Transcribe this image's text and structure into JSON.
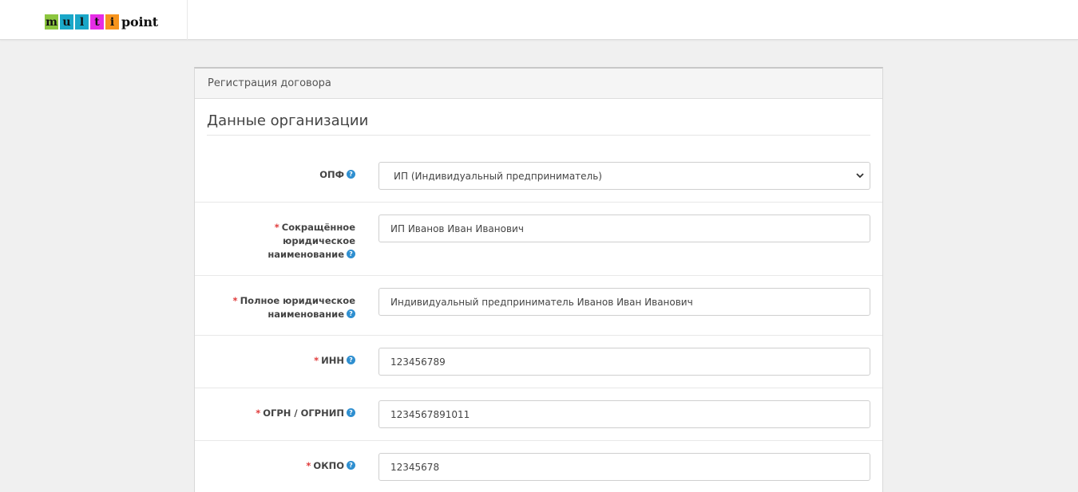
{
  "brand": {
    "letters": [
      {
        "char": "m",
        "color": "#8cc63f"
      },
      {
        "char": "u",
        "color": "#1aa7c8"
      },
      {
        "char": "l",
        "color": "#1aa7c8"
      },
      {
        "char": "t",
        "color": "#e52de5"
      },
      {
        "char": "i",
        "color": "#f7941d"
      }
    ],
    "suffix": "point"
  },
  "panel": {
    "title": "Регистрация договора",
    "section_title": "Данные организации"
  },
  "form": {
    "opf": {
      "label": "ОПФ",
      "value": "ИП (Индивидуальный предприниматель)"
    },
    "short_name": {
      "required": "*",
      "label": "Сокращённое юридическое наименование",
      "value": "ИП Иванов Иван Иванович"
    },
    "full_name": {
      "required": "*",
      "label": "Полное юридическое наименование",
      "value": "Индивидуальный предприниматель Иванов Иван Иванович"
    },
    "inn": {
      "required": "*",
      "label": "ИНН",
      "value": "123456789"
    },
    "ogrn": {
      "required": "*",
      "label": "ОГРН / ОГРНИП",
      "value": "1234567891011"
    },
    "okpo": {
      "required": "*",
      "label": "ОКПО",
      "value": "12345678"
    }
  },
  "help_glyph": "?",
  "icons": {
    "help": "question-circle-icon",
    "select": "chevron-down-icon"
  },
  "colors": {
    "required": "#e03b3b",
    "help": "#2f8fd0"
  }
}
